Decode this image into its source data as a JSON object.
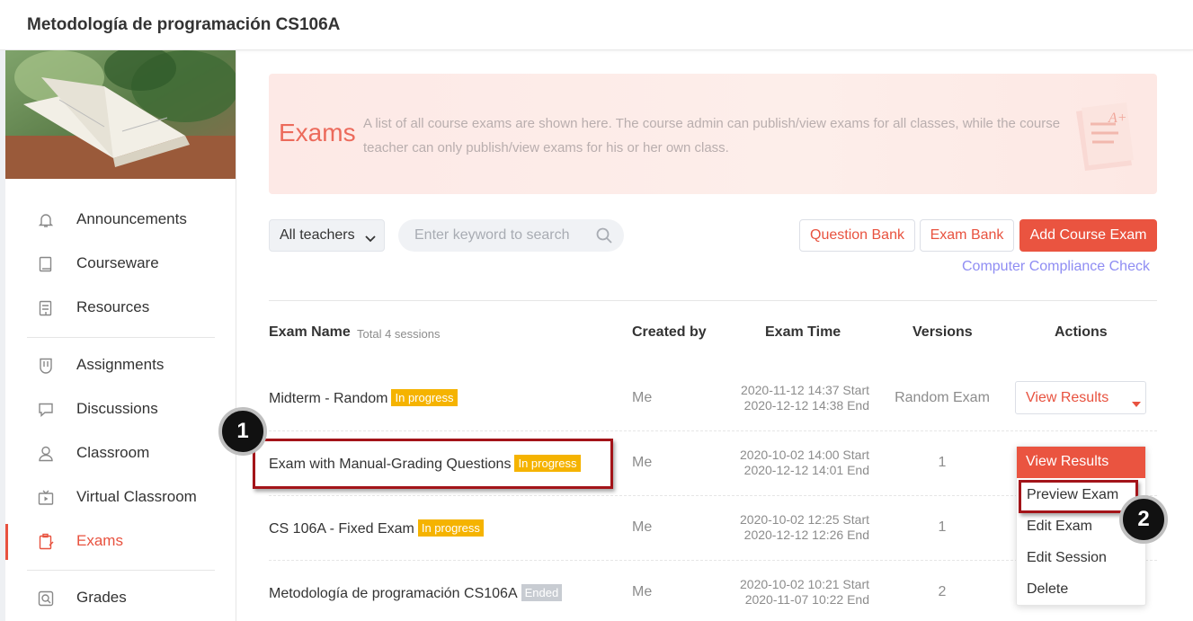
{
  "course_title": "Metodología de programación CS106A",
  "nav": [
    {
      "label": "Announcements",
      "icon": "bell-icon"
    },
    {
      "label": "Courseware",
      "icon": "book-icon"
    },
    {
      "label": "Resources",
      "icon": "folder-icon"
    },
    {
      "label": "Assignments",
      "icon": "bookmark-shield-icon"
    },
    {
      "label": "Discussions",
      "icon": "chat-icon"
    },
    {
      "label": "Classroom",
      "icon": "person-icon"
    },
    {
      "label": "Virtual Classroom",
      "icon": "video-icon"
    },
    {
      "label": "Exams",
      "icon": "clipboard-icon",
      "active": true
    },
    {
      "label": "Grades",
      "icon": "magnifier-icon"
    }
  ],
  "banner": {
    "title": "Exams",
    "description": "A list of all course exams are shown here. The course admin can publish/view exams for all classes, while the course teacher can only publish/view exams for his or her own class."
  },
  "toolbar": {
    "teacher_filter": "All teachers",
    "search_placeholder": "Enter keyword to search",
    "question_bank": "Question Bank",
    "exam_bank": "Exam Bank",
    "add_exam": "Add Course Exam",
    "compliance_check": "Computer Compliance Check"
  },
  "table": {
    "headers": {
      "name": "Exam Name",
      "total": "Total 4 sessions",
      "created_by": "Created by",
      "time": "Exam Time",
      "versions": "Versions",
      "actions": "Actions"
    },
    "rows": [
      {
        "name": "Midterm - Random",
        "status": "In progress",
        "created_by": "Me",
        "start": "2020-11-12 14:37 Start",
        "end": "2020-12-12 14:38 End",
        "versions": "Random Exam"
      },
      {
        "name": "Exam with Manual-Grading Questions",
        "status": "In progress",
        "created_by": "Me",
        "start": "2020-10-02 14:00 Start",
        "end": "2020-12-12 14:01 End",
        "versions": "1"
      },
      {
        "name": "CS 106A - Fixed Exam",
        "status": "In progress",
        "created_by": "Me",
        "start": "2020-10-02 12:25 Start",
        "end": "2020-12-12 12:26 End",
        "versions": "1"
      },
      {
        "name": "Metodología de programación CS106A",
        "status": "Ended",
        "created_by": "Me",
        "start": "2020-10-02 10:21 Start",
        "end": "2020-11-07 10:22 End",
        "versions": "2"
      }
    ],
    "action_label": "View Results"
  },
  "dropdown": {
    "head": "View Results",
    "items": [
      "Preview Exam",
      "Edit Exam",
      "Edit Session",
      "Delete"
    ]
  },
  "annotations": {
    "step1": "1",
    "step2": "2"
  },
  "colors": {
    "accent": "#ea5440",
    "badge_progress": "#f5b300",
    "badge_ended": "#c8ccd2",
    "link": "#8f8df3",
    "highlight": "#a31419"
  }
}
